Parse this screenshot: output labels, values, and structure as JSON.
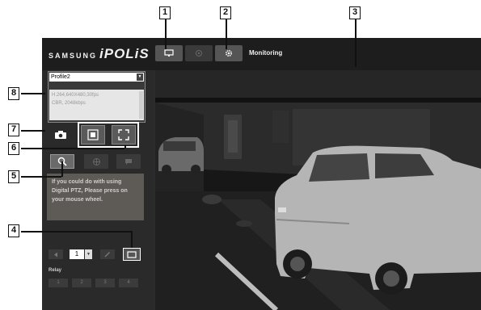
{
  "brand": {
    "maker": "SAMSUNG",
    "product": "iPOLiS"
  },
  "header": {
    "title": "Monitoring"
  },
  "profile": {
    "selected": "Profile2",
    "info_line1": "H.264,640X480,30fps",
    "info_line2": "CBR, 2048kbps"
  },
  "ptz": {
    "message": "If you could do with using Digital PTZ, Please press on your mouse wheel."
  },
  "preset": {
    "value": "1"
  },
  "relay": {
    "label": "Relay",
    "buttons": [
      "1",
      "2",
      "3",
      "4"
    ]
  },
  "callouts": [
    "1",
    "2",
    "3",
    "4",
    "5",
    "6",
    "7",
    "8"
  ],
  "colors": {
    "panel": "#2c2c2c",
    "topbar": "#1d1d1d",
    "ptz_bg": "#5e5a55"
  },
  "icons": [
    "monitor-icon",
    "ptz-icon",
    "gear-icon",
    "camera-icon",
    "fit-icon",
    "fullscreen-icon",
    "zoom-icon",
    "crosshair-icon",
    "chat-icon",
    "pen-icon",
    "rect-icon"
  ]
}
